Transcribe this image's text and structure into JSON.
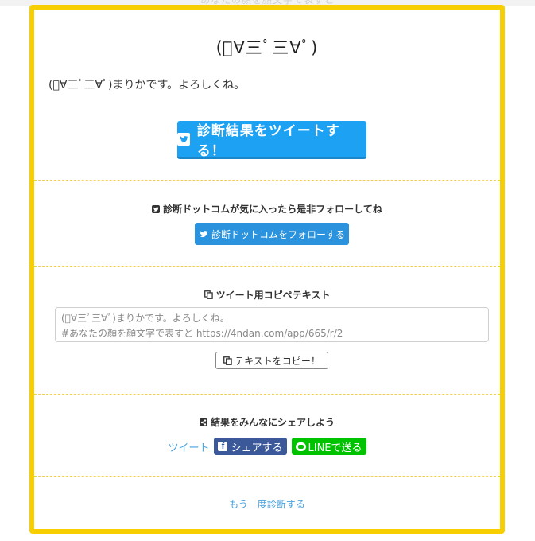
{
  "header": {
    "faded_title": "あなたの顔を顔文字で表すと"
  },
  "result": {
    "title": "(ﾟ∀三ﾟ三∀ﾟ)",
    "text": "(ﾟ∀三ﾟ三∀ﾟ)まりかです。よろしくね。",
    "tweet_button": "診断結果をツイートする！"
  },
  "follow": {
    "heading": "診断ドットコムが気に入ったら是非フォローしてね",
    "button": "診断ドットコムをフォローする"
  },
  "copy": {
    "heading": "ツイート用コピペテキスト",
    "line1": "(ﾟ∀三ﾟ三∀ﾟ)まりかです。よろしくね。",
    "line2": "#あなたの顔を顔文字で表すと https://4ndan.com/app/665/r/2",
    "button": "テキストをコピー！"
  },
  "share": {
    "heading": "結果をみんなにシェアしよう",
    "tweet_link": "ツイート",
    "facebook": "シェアする",
    "facebook_letter": "f",
    "line": "LINEで送る"
  },
  "retry": {
    "label": "もう一度診断する"
  },
  "colors": {
    "frame": "#f7cf00",
    "twitter": "#1da1f2",
    "facebook": "#3b5998",
    "line": "#00c300",
    "link": "#4aa3df"
  },
  "icons": [
    "twitter-icon",
    "copy-icon",
    "share-icon",
    "facebook-icon",
    "line-icon"
  ]
}
